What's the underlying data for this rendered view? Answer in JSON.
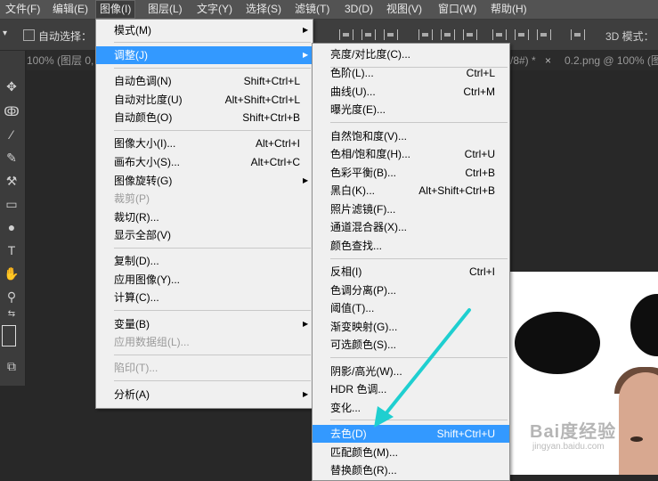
{
  "menubar": {
    "items": [
      "文件(F)",
      "编辑(E)",
      "图像(I)",
      "图层(L)",
      "文字(Y)",
      "选择(S)",
      "滤镜(T)",
      "3D(D)",
      "视图(V)",
      "窗口(W)",
      "帮助(H)"
    ],
    "active_index": 2
  },
  "options": {
    "auto_select_label": "自动选择：",
    "three_d_mode_label": "3D 模式："
  },
  "tabs": [
    "100% (图层 0, ...",
    "/8#) *",
    "0.2.png @ 100% (图"
  ],
  "tab_close": "×",
  "image_menu": {
    "items": [
      {
        "label": "模式(M)",
        "shortcut": "",
        "submenu": true,
        "disabled": false
      },
      {
        "label": "调整(J)",
        "shortcut": "",
        "submenu": true,
        "disabled": false,
        "highlighted": true
      },
      {
        "label": "自动色调(N)",
        "shortcut": "Shift+Ctrl+L",
        "submenu": false,
        "disabled": false
      },
      {
        "label": "自动对比度(U)",
        "shortcut": "Alt+Shift+Ctrl+L",
        "submenu": false,
        "disabled": false
      },
      {
        "label": "自动颜色(O)",
        "shortcut": "Shift+Ctrl+B",
        "submenu": false,
        "disabled": false
      },
      {
        "label": "图像大小(I)...",
        "shortcut": "Alt+Ctrl+I",
        "submenu": false,
        "disabled": false
      },
      {
        "label": "画布大小(S)...",
        "shortcut": "Alt+Ctrl+C",
        "submenu": false,
        "disabled": false
      },
      {
        "label": "图像旋转(G)",
        "shortcut": "",
        "submenu": true,
        "disabled": false
      },
      {
        "label": "裁剪(P)",
        "shortcut": "",
        "submenu": false,
        "disabled": true
      },
      {
        "label": "裁切(R)...",
        "shortcut": "",
        "submenu": false,
        "disabled": false
      },
      {
        "label": "显示全部(V)",
        "shortcut": "",
        "submenu": false,
        "disabled": false
      },
      {
        "label": "复制(D)...",
        "shortcut": "",
        "submenu": false,
        "disabled": false
      },
      {
        "label": "应用图像(Y)...",
        "shortcut": "",
        "submenu": false,
        "disabled": false
      },
      {
        "label": "计算(C)...",
        "shortcut": "",
        "submenu": false,
        "disabled": false
      },
      {
        "label": "变量(B)",
        "shortcut": "",
        "submenu": true,
        "disabled": false
      },
      {
        "label": "应用数据组(L)...",
        "shortcut": "",
        "submenu": false,
        "disabled": true
      },
      {
        "label": "陷印(T)...",
        "shortcut": "",
        "submenu": false,
        "disabled": true
      },
      {
        "label": "分析(A)",
        "shortcut": "",
        "submenu": true,
        "disabled": false
      }
    ]
  },
  "adjust_menu": {
    "items": [
      {
        "label": "亮度/对比度(C)...",
        "shortcut": ""
      },
      {
        "label": "色阶(L)...",
        "shortcut": "Ctrl+L"
      },
      {
        "label": "曲线(U)...",
        "shortcut": "Ctrl+M"
      },
      {
        "label": "曝光度(E)...",
        "shortcut": ""
      },
      {
        "label": "自然饱和度(V)...",
        "shortcut": ""
      },
      {
        "label": "色相/饱和度(H)...",
        "shortcut": "Ctrl+U"
      },
      {
        "label": "色彩平衡(B)...",
        "shortcut": "Ctrl+B"
      },
      {
        "label": "黑白(K)...",
        "shortcut": "Alt+Shift+Ctrl+B"
      },
      {
        "label": "照片滤镜(F)...",
        "shortcut": ""
      },
      {
        "label": "通道混合器(X)...",
        "shortcut": ""
      },
      {
        "label": "颜色查找...",
        "shortcut": ""
      },
      {
        "label": "反相(I)",
        "shortcut": "Ctrl+I"
      },
      {
        "label": "色调分离(P)...",
        "shortcut": ""
      },
      {
        "label": "阈值(T)...",
        "shortcut": ""
      },
      {
        "label": "渐变映射(G)...",
        "shortcut": ""
      },
      {
        "label": "可选颜色(S)...",
        "shortcut": ""
      },
      {
        "label": "阴影/高光(W)...",
        "shortcut": ""
      },
      {
        "label": "HDR 色调...",
        "shortcut": ""
      },
      {
        "label": "变化...",
        "shortcut": ""
      },
      {
        "label": "去色(D)",
        "shortcut": "Shift+Ctrl+U",
        "highlighted": true
      },
      {
        "label": "匹配颜色(M)...",
        "shortcut": ""
      },
      {
        "label": "替换颜色(R)...",
        "shortcut": ""
      }
    ]
  },
  "watermark": {
    "brand": "Bai度经验",
    "url": "jingyan.baidu.com"
  },
  "colors": {
    "highlight": "#3399ff",
    "arrow": "#1fcfd0"
  }
}
